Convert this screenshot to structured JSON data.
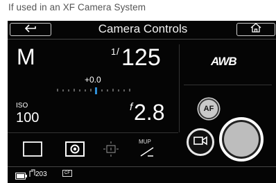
{
  "caption": "If used in an XF Camera System",
  "topbar": {
    "title": "Camera Controls",
    "back_icon": "back-arrow-icon",
    "home_icon": "home-icon"
  },
  "exposure": {
    "mode": "M",
    "shutter_numerator": "1",
    "shutter_slash": "/",
    "shutter_denominator": "125",
    "ev_value": "+0.0",
    "iso_label": "ISO",
    "iso_value": "100",
    "aperture_prefix": "f",
    "aperture_value": "2.8"
  },
  "metering": {
    "icons": [
      "spot-frame-icon",
      "center-weighted-icon",
      "average-metering-icon",
      "mirror-up-icon"
    ],
    "mup_label": "MUP"
  },
  "right_panel": {
    "white_balance": "AWB",
    "af_label": "AF",
    "video_icon": "video-camera-icon",
    "shutter_icon": "shutter-release-icon"
  },
  "status": {
    "battery_icon": "battery-icon",
    "shots_remaining": "203",
    "card_label": "CF"
  },
  "colors": {
    "screen_bg": "#050505",
    "ev_marker": "#2f8fd6"
  }
}
